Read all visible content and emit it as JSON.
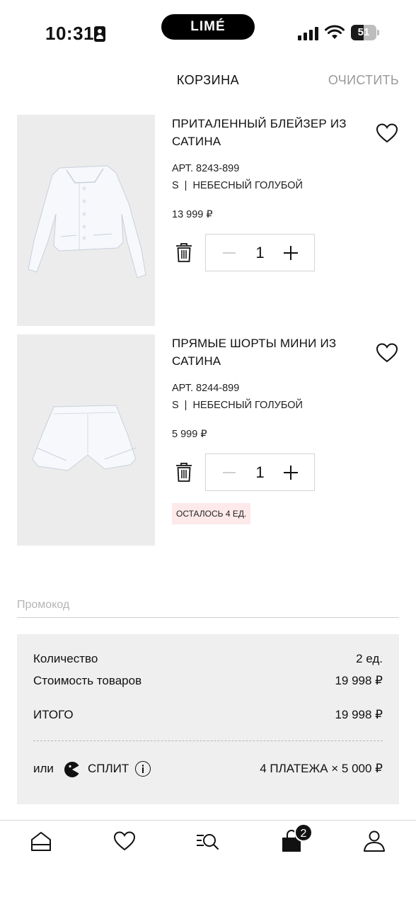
{
  "status_bar": {
    "time": "10:31",
    "island_logo": "LIMÉ",
    "battery_level": "51",
    "battery_fraction": 0.51
  },
  "header": {
    "title": "КОРЗИНА",
    "clear_label": "ОЧИСТИТЬ"
  },
  "cart": {
    "items": [
      {
        "name": "ПРИТАЛЕННЫЙ БЛЕЙЗЕР ИЗ САТИНА",
        "article": "АРТ. 8243-899",
        "size": "S",
        "separator": "|",
        "color": "НЕБЕСНЫЙ ГОЛУБОЙ",
        "price": "13 999 ₽",
        "quantity": "1",
        "image_icon": "blazer-image"
      },
      {
        "name": "ПРЯМЫЕ ШОРТЫ МИНИ ИЗ САТИНА",
        "article": "АРТ. 8244-899",
        "size": "S",
        "separator": "|",
        "color": "НЕБЕСНЫЙ ГОЛУБОЙ",
        "price": "5 999 ₽",
        "quantity": "1",
        "stock_note": "ОСТАЛОСЬ 4 ЕД.",
        "image_icon": "shorts-image"
      }
    ]
  },
  "promo": {
    "placeholder": "Промокод",
    "value": ""
  },
  "summary": {
    "quantity_label": "Количество",
    "quantity_value": "2 ед.",
    "goods_cost_label": "Стоимость товаров",
    "goods_cost_value": "19 998 ₽",
    "total_label": "ИТОГО",
    "total_value": "19 998 ₽",
    "split_or": "или",
    "split_name": "СПЛИТ",
    "split_payments": "4 ПЛАТЕЖА × 5 000 ₽"
  },
  "bottom_nav": {
    "items": [
      "home-icon",
      "heart-icon",
      "catalog-search-icon",
      "bag-icon",
      "profile-icon"
    ],
    "cart_badge": "2"
  },
  "colors": {
    "accent": "#111111",
    "muted_text": "#9a9a9a",
    "image_bg": "#ececec",
    "summary_bg": "#efefef",
    "stock_badge_bg": "#fde9ea"
  }
}
